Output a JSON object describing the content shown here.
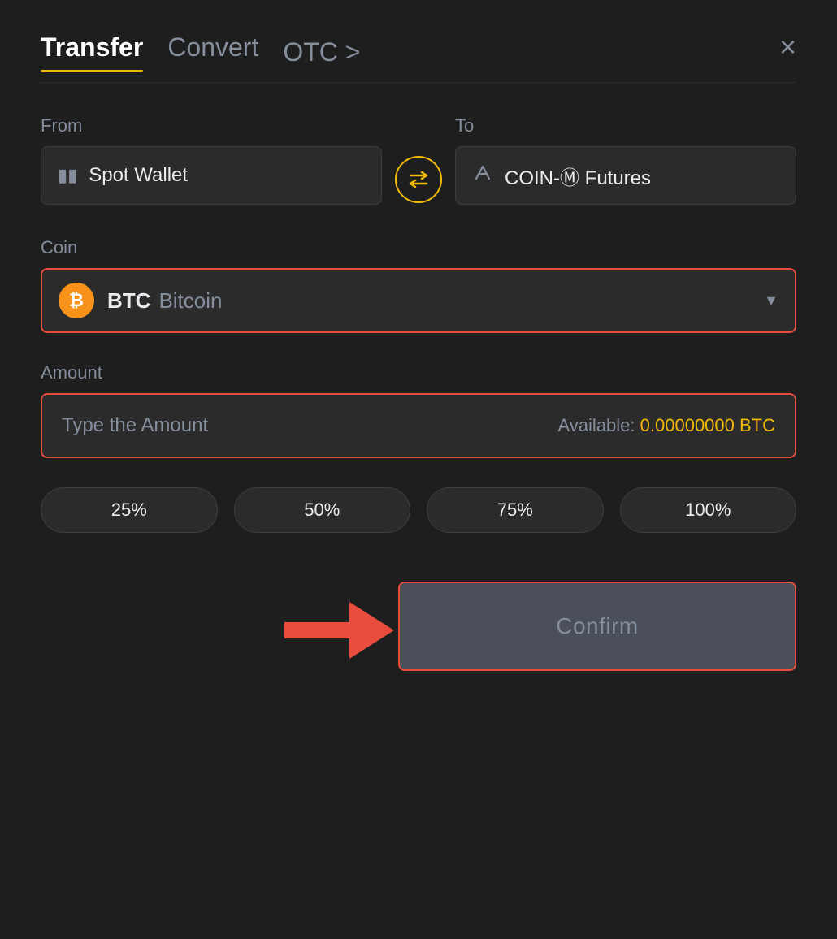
{
  "header": {
    "tab_transfer": "Transfer",
    "tab_convert": "Convert",
    "tab_otc": "OTC >",
    "close_label": "×"
  },
  "from": {
    "label": "From",
    "wallet_icon": "▬",
    "wallet_name": "Spot Wallet"
  },
  "to": {
    "label": "To",
    "wallet_icon": "↑",
    "wallet_name": "COIN-Ⓜ Futures"
  },
  "swap": {
    "icon": "⇄"
  },
  "coin": {
    "label": "Coin",
    "ticker": "BTC",
    "name": "Bitcoin"
  },
  "amount": {
    "label": "Amount",
    "placeholder": "Type the Amount",
    "available_label": "Available:",
    "available_value": "0.00000000 BTC"
  },
  "pct_buttons": [
    "25%",
    "50%",
    "75%",
    "100%"
  ],
  "confirm": {
    "label": "Confirm"
  }
}
